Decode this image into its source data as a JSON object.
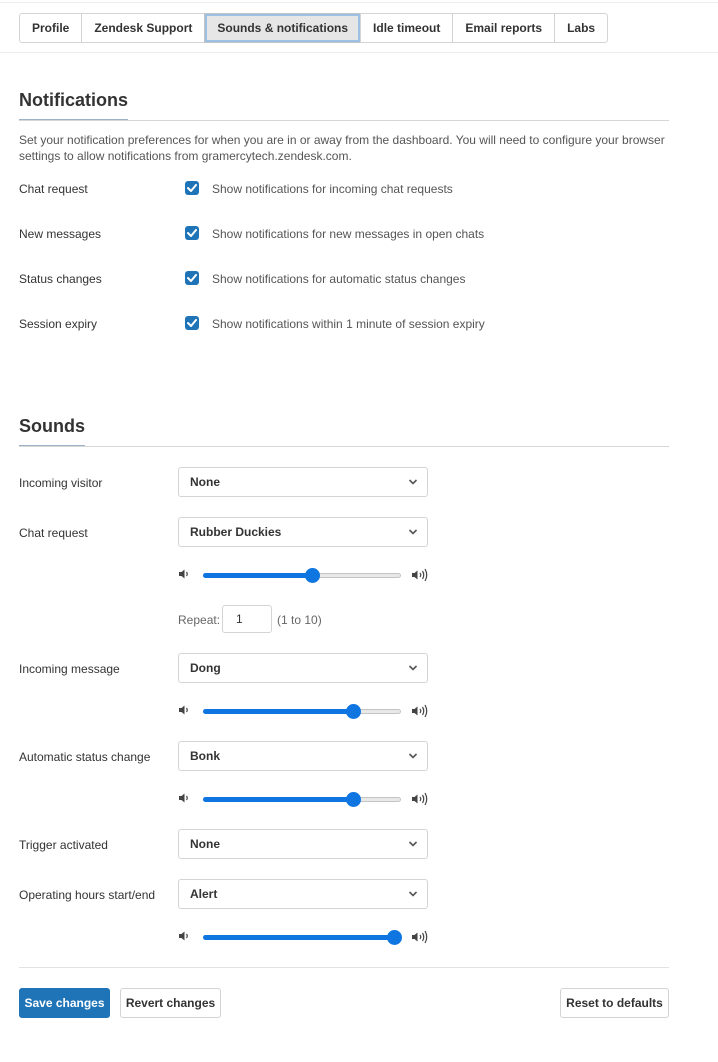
{
  "tabs": [
    {
      "label": "Profile",
      "active": false
    },
    {
      "label": "Zendesk Support",
      "active": false
    },
    {
      "label": "Sounds & notifications",
      "active": true
    },
    {
      "label": "Idle timeout",
      "active": false
    },
    {
      "label": "Email reports",
      "active": false
    },
    {
      "label": "Labs",
      "active": false
    }
  ],
  "notifications": {
    "title": "Notifications",
    "description": "Set your notification preferences for when you are in or away from the dashboard. You will need to configure your browser settings to allow notifications from gramercytech.zendesk.com.",
    "rows": [
      {
        "label": "Chat request",
        "checked": true,
        "text": "Show notifications for incoming chat requests"
      },
      {
        "label": "New messages",
        "checked": true,
        "text": "Show notifications for new messages in open chats"
      },
      {
        "label": "Status changes",
        "checked": true,
        "text": "Show notifications for automatic status changes"
      },
      {
        "label": "Session expiry",
        "checked": true,
        "text": "Show notifications within 1 minute of session expiry"
      }
    ]
  },
  "sounds": {
    "title": "Sounds",
    "rows": [
      {
        "label": "Incoming visitor",
        "value": "None"
      },
      {
        "label": "Chat request",
        "value": "Rubber Duckies",
        "volume": 0.55
      },
      {
        "label": "Incoming message",
        "value": "Dong",
        "volume": 0.76
      },
      {
        "label": "Automatic status change",
        "value": "Bonk",
        "volume": 0.76
      },
      {
        "label": "Trigger activated",
        "value": "None"
      },
      {
        "label": "Operating hours start/end",
        "value": "Alert",
        "volume": 1.0
      }
    ],
    "repeat": {
      "label": "Repeat:",
      "value": "1",
      "hint": "(1 to 10)"
    }
  },
  "footer": {
    "save_label": "Save changes",
    "revert_label": "Revert changes",
    "reset_label": "Reset to defaults"
  },
  "colors": {
    "accent": "#1f73b7",
    "slider": "#0f75e0"
  }
}
